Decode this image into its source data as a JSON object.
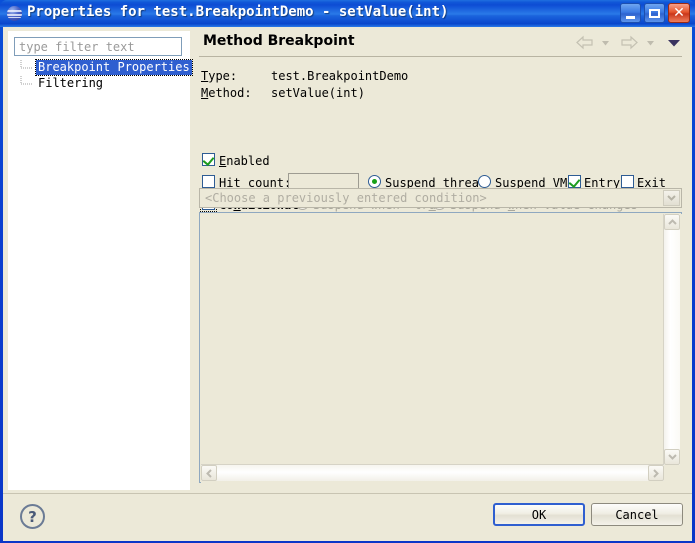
{
  "window": {
    "title": "Properties for test.BreakpointDemo - setValue(int)",
    "icon": "eclipse-sphere-icon",
    "controls": {
      "minimize": "minimize-button",
      "maximize": "maximize-button",
      "close": "close-button",
      "close_glyph": "✕"
    }
  },
  "sidebar": {
    "filter": {
      "value": "",
      "placeholder": "type filter text"
    },
    "items": [
      {
        "label": "Breakpoint Properties",
        "selected": true
      },
      {
        "label": "Filtering",
        "selected": false
      }
    ]
  },
  "main": {
    "page_title": "Method Breakpoint",
    "nav": {
      "back": "back-arrow-icon",
      "back_menu": "back-dropdown-icon",
      "forward": "forward-arrow-icon",
      "forward_menu": "forward-dropdown-icon",
      "menu": "view-menu-icon"
    },
    "info": {
      "type_label": "Type:",
      "type_mnemonic": "T",
      "type_value": "test.BreakpointDemo",
      "method_label": "Method:",
      "method_mnemonic": "M",
      "method_value": "setValue(int)"
    },
    "enabled": {
      "label": "Enabled",
      "mnemonic": "E",
      "rest": "nabled",
      "checked": true
    },
    "hit_count": {
      "label_pre": "H",
      "label_rest": "it count:",
      "checked": false,
      "value": "",
      "enabled": false
    },
    "suspend_thread": {
      "pre": "S",
      "rest": "uspend thread",
      "selected": true
    },
    "suspend_vm": {
      "pre": "Suspend ",
      "mn": "V",
      "rest": "M",
      "selected": false
    },
    "entry": {
      "pre": "Entr",
      "mn": "y",
      "rest": "",
      "checked": true
    },
    "exit": {
      "pre": "E",
      "mn": "x",
      "rest": "it",
      "checked": false
    },
    "conditional": {
      "pre": "Co",
      "mn": "n",
      "rest": "ditional",
      "checked": false,
      "focused": true
    },
    "suspend_when_true": {
      "pre": "Suspend when 'tr",
      "mn": "u",
      "rest": "e'",
      "selected": true,
      "enabled": false
    },
    "suspend_when_changes": {
      "pre": "Suspend ",
      "mn": "w",
      "rest": "hen value changes",
      "selected": false,
      "enabled": false
    },
    "condition_combo": {
      "value": "<Choose a previously entered condition>",
      "enabled": false,
      "dropdown_icon": "chevron-down-icon"
    },
    "condition_editor": {
      "text": "",
      "enabled": false,
      "scroll_up_icon": "chevron-up-icon",
      "scroll_down_icon": "chevron-down-icon",
      "scroll_left_icon": "chevron-left-icon",
      "scroll_right_icon": "chevron-right-icon"
    }
  },
  "footer": {
    "help": "?",
    "ok_label": "OK",
    "cancel_label": "Cancel"
  },
  "colors": {
    "dialog_bg": "#ece9d8",
    "title_blue": "#0a46cc",
    "selection_blue": "#2f5fd0",
    "check_green": "#1f9c1f",
    "disabled_text": "#a9a79c"
  }
}
